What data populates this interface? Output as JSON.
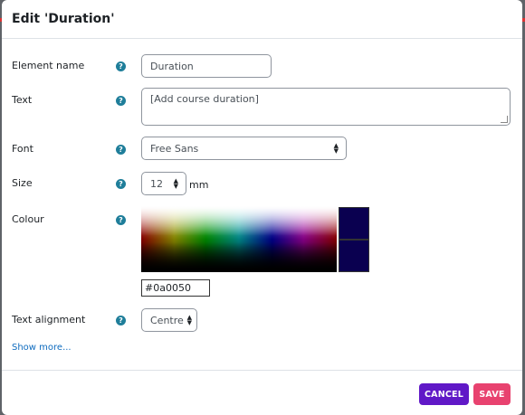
{
  "modal": {
    "title": "Edit 'Duration'"
  },
  "form": {
    "element_name": {
      "label": "Element name",
      "value": "Duration"
    },
    "text": {
      "label": "Text",
      "value": "[Add course duration]"
    },
    "font": {
      "label": "Font",
      "value": "Free Sans"
    },
    "size": {
      "label": "Size",
      "value": "12",
      "unit": "mm"
    },
    "colour": {
      "label": "Colour",
      "hex": "#0a0050"
    },
    "alignment": {
      "label": "Text alignment",
      "value": "Centre"
    },
    "help_glyph": "?",
    "show_more": "Show more..."
  },
  "footer": {
    "cancel_label": "CANCEL",
    "save_label": "SAVE"
  },
  "colors": {
    "cancel_button": "#6018c7",
    "save_button": "#e8426f",
    "selected_colour": "#0a0050",
    "help_icon": "#1f7e9a",
    "link": "#0f6cbf"
  },
  "icons": {
    "help": "question-circle-icon",
    "select": "sort-arrows-icon"
  }
}
